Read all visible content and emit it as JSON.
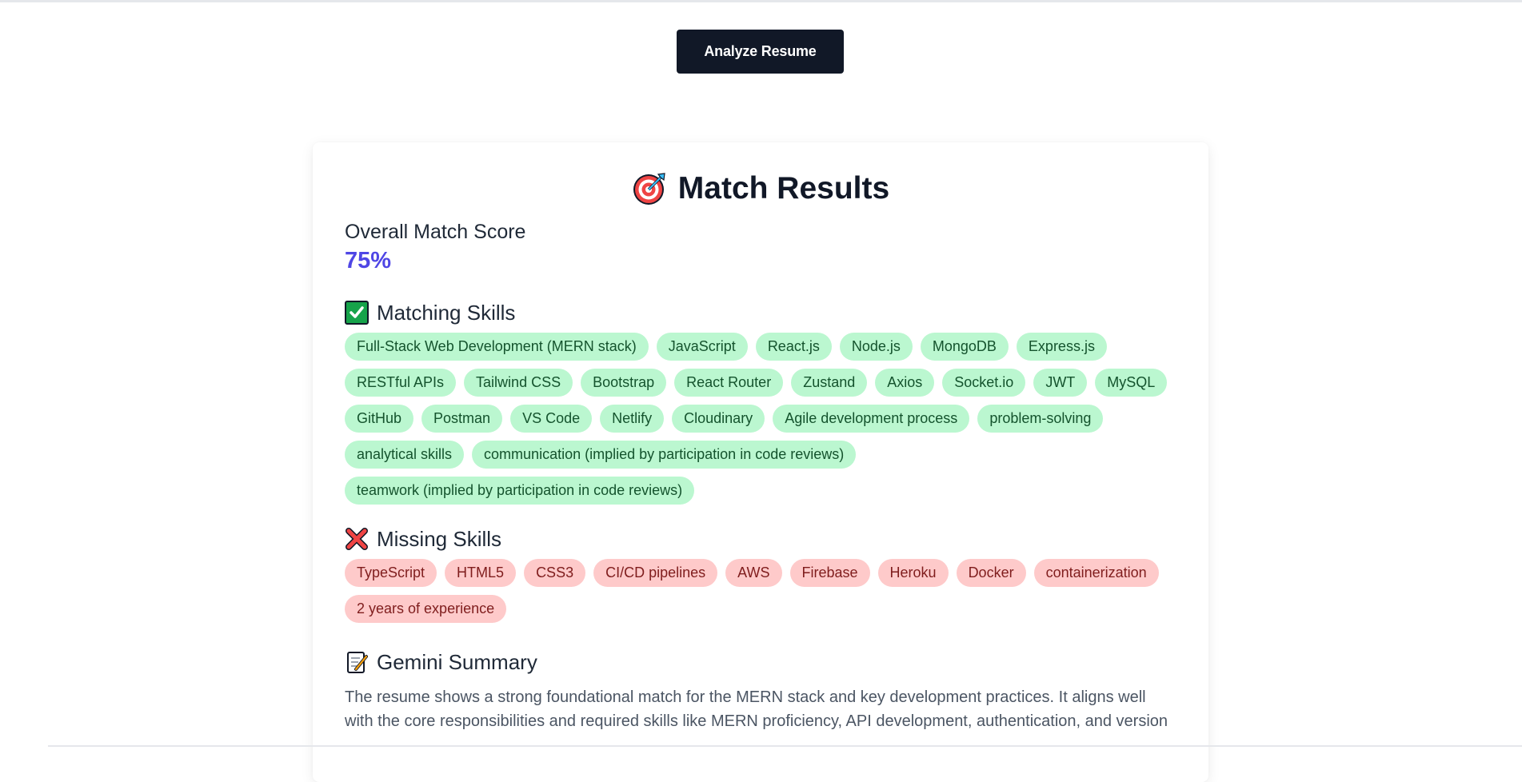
{
  "toolbar": {
    "analyze_label": "Analyze Resume"
  },
  "results": {
    "title": "Match Results",
    "title_icon": "target-icon",
    "score_label": "Overall Match Score",
    "score_value": "75%",
    "score_fraction": 0.75,
    "accent_color": "#4f46e5"
  },
  "matching": {
    "heading": "Matching Skills",
    "icon": "check-mark-icon",
    "color": "#bbf7d0",
    "skills": [
      "Full-Stack Web Development (MERN stack)",
      "JavaScript",
      "React.js",
      "Node.js",
      "MongoDB",
      "Express.js",
      "RESTful APIs",
      "Tailwind CSS",
      "Bootstrap",
      "React Router",
      "Zustand",
      "Axios",
      "Socket.io",
      "JWT",
      "MySQL",
      "GitHub",
      "Postman",
      "VS Code",
      "Netlify",
      "Cloudinary",
      "Agile development process",
      "problem-solving",
      "analytical skills",
      "communication (implied by participation in code reviews)",
      "teamwork (implied by participation in code reviews)"
    ]
  },
  "missing": {
    "heading": "Missing Skills",
    "icon": "cross-mark-icon",
    "color": "#fecaca",
    "skills": [
      "TypeScript",
      "HTML5",
      "CSS3",
      "CI/CD pipelines",
      "AWS",
      "Firebase",
      "Heroku",
      "Docker",
      "containerization",
      "2 years of experience"
    ]
  },
  "summary": {
    "heading": "Gemini Summary",
    "icon": "memo-icon",
    "text": "The resume shows a strong foundational match for the MERN stack and key development practices. It aligns well with the core responsibilities and required skills like MERN proficiency, API development, authentication, and version"
  }
}
